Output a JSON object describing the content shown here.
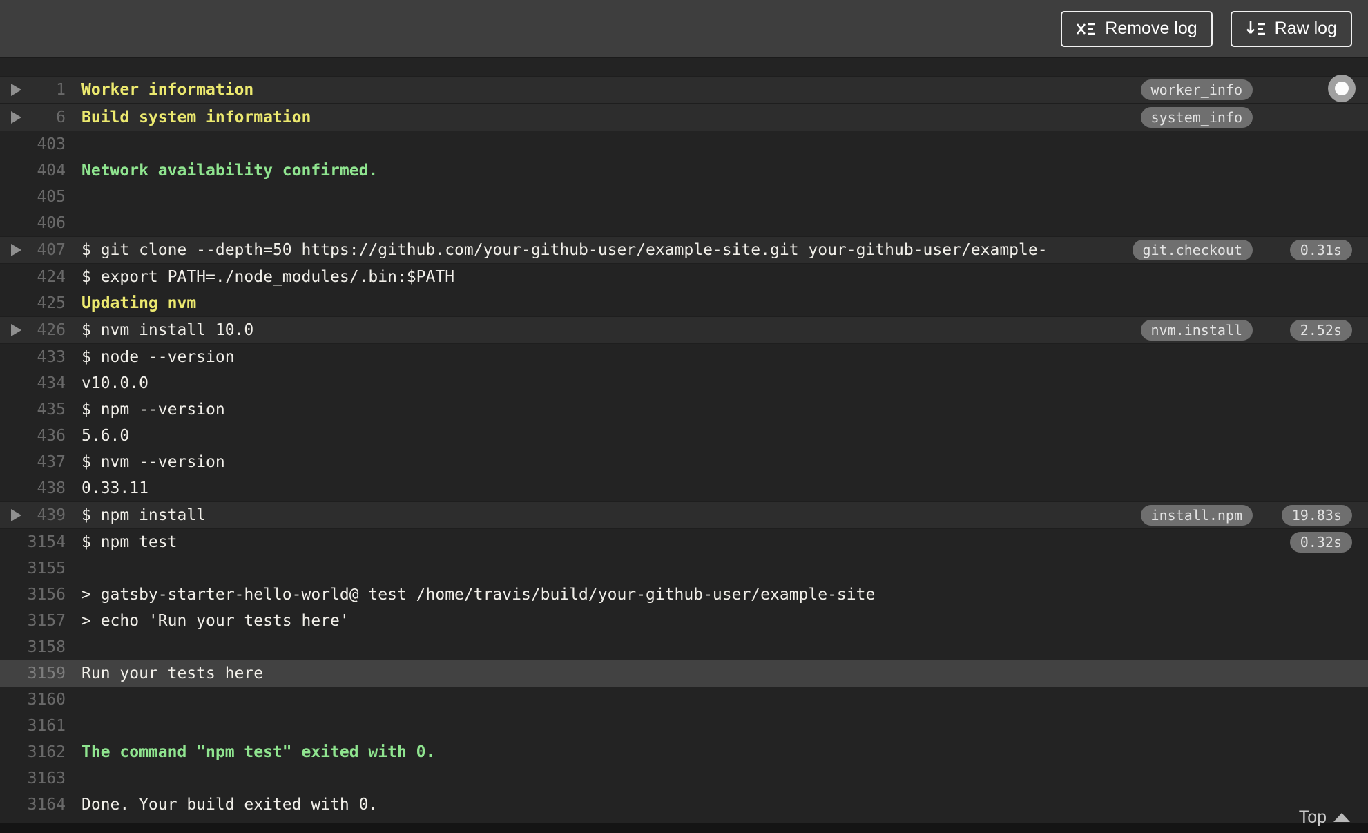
{
  "toolbar": {
    "remove_log_label": "Remove log",
    "raw_log_label": "Raw log"
  },
  "footer": {
    "top_label": "Top"
  },
  "colors": {
    "yellow": "#ece96f",
    "green": "#8fe48f",
    "badge_bg": "#6f6f6f",
    "log_bg": "#232323",
    "header_bg": "#3e3e3e",
    "section_row_bg": "#2d2d2d",
    "highlight_row_bg": "#424242"
  },
  "log": {
    "rows": [
      {
        "num": "1",
        "text": "Worker information",
        "style": "yellow",
        "fold": true,
        "section": true,
        "tag": "worker_info"
      },
      {
        "num": "6",
        "text": "Build system information",
        "style": "yellow",
        "fold": true,
        "section": true,
        "tag": "system_info"
      },
      {
        "num": "403",
        "text": ""
      },
      {
        "num": "404",
        "text": "Network availability confirmed.",
        "style": "green"
      },
      {
        "num": "405",
        "text": ""
      },
      {
        "num": "406",
        "text": ""
      },
      {
        "num": "407",
        "text": "$ git clone --depth=50 https://github.com/your-github-user/example-site.git your-github-user/example-",
        "fold": true,
        "section": true,
        "tag": "git.checkout",
        "duration": "0.31s"
      },
      {
        "num": "424",
        "text": "$ export PATH=./node_modules/.bin:$PATH"
      },
      {
        "num": "425",
        "text": "Updating nvm",
        "style": "yellow"
      },
      {
        "num": "426",
        "text": "$ nvm install 10.0",
        "fold": true,
        "section": true,
        "tag": "nvm.install",
        "duration": "2.52s"
      },
      {
        "num": "433",
        "text": "$ node --version"
      },
      {
        "num": "434",
        "text": "v10.0.0"
      },
      {
        "num": "435",
        "text": "$ npm --version"
      },
      {
        "num": "436",
        "text": "5.6.0"
      },
      {
        "num": "437",
        "text": "$ nvm --version"
      },
      {
        "num": "438",
        "text": "0.33.11"
      },
      {
        "num": "439",
        "text": "$ npm install",
        "fold": true,
        "section": true,
        "tag": "install.npm",
        "duration": "19.83s"
      },
      {
        "num": "3154",
        "text": "$ npm test",
        "duration": "0.32s"
      },
      {
        "num": "3155",
        "text": ""
      },
      {
        "num": "3156",
        "text": "> gatsby-starter-hello-world@ test /home/travis/build/your-github-user/example-site"
      },
      {
        "num": "3157",
        "text": "> echo 'Run your tests here'"
      },
      {
        "num": "3158",
        "text": ""
      },
      {
        "num": "3159",
        "text": "Run your tests here",
        "highlight": true
      },
      {
        "num": "3160",
        "text": ""
      },
      {
        "num": "3161",
        "text": ""
      },
      {
        "num": "3162",
        "text": "The command \"npm test\" exited with 0.",
        "style": "green"
      },
      {
        "num": "3163",
        "text": ""
      },
      {
        "num": "3164",
        "text": "Done. Your build exited with 0."
      }
    ]
  }
}
